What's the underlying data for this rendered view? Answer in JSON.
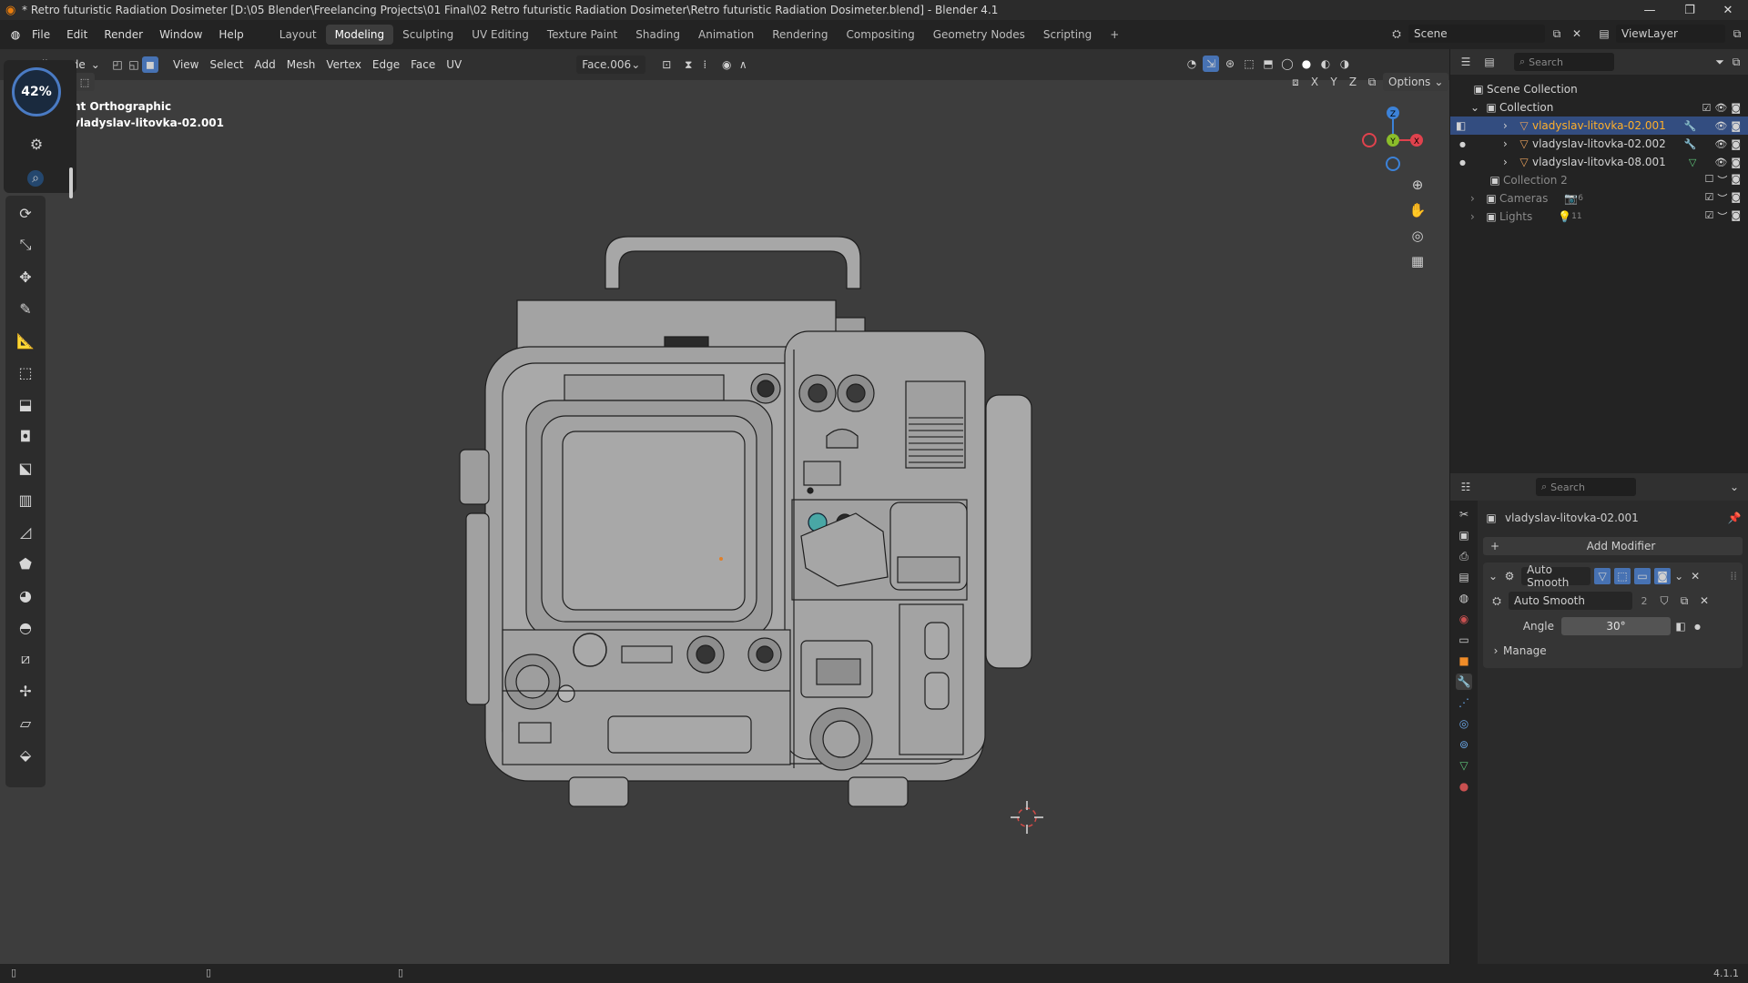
{
  "window": {
    "title": "* Retro futuristic Radiation Dosimeter [D:\\05 Blender\\Freelancing Projects\\01 Final\\02 Retro futuristic Radiation Dosimeter\\Retro futuristic Radiation Dosimeter.blend] - Blender 4.1"
  },
  "menubar": {
    "menus": [
      "File",
      "Edit",
      "Render",
      "Window",
      "Help"
    ],
    "workspaces": [
      "Layout",
      "Modeling",
      "Sculpting",
      "UV Editing",
      "Texture Paint",
      "Shading",
      "Animation",
      "Rendering",
      "Compositing",
      "Geometry Nodes",
      "Scripting",
      "+"
    ],
    "active_workspace": "Modeling",
    "scene_label": "Scene",
    "viewlayer_label": "ViewLayer"
  },
  "viewport_header": {
    "mode": "Edit Mode",
    "menus": [
      "View",
      "Select",
      "Add",
      "Mesh",
      "Vertex",
      "Edge",
      "Face",
      "UV"
    ],
    "active_face": "Face.006",
    "options_label": "Options",
    "axes": [
      "X",
      "Y",
      "Z"
    ]
  },
  "viewport": {
    "view_name": "nt Orthographic",
    "object_name": "vladyslav-litovka-02.001",
    "zoom_badge": "42%",
    "gizmo_axes": [
      "Z",
      "Y",
      "X"
    ]
  },
  "outliner": {
    "search_placeholder": "Search",
    "scene_collection": "Scene Collection",
    "collection": "Collection",
    "objects": [
      "vladyslav-litovka-02.001",
      "vladyslav-litovka-02.002",
      "vladyslav-litovka-08.001"
    ],
    "collection2": "Collection 2",
    "cameras": "Cameras",
    "cameras_count": "6",
    "lights": "Lights",
    "lights_count": "11"
  },
  "properties": {
    "search_placeholder": "Search",
    "object_name": "vladyslav-litovka-02.001",
    "add_modifier": "Add Modifier",
    "modifier_name": "Auto Smooth",
    "node_group": "Auto Smooth",
    "node_users": "2",
    "angle_label": "Angle",
    "angle_value": "30°",
    "manage_label": "Manage"
  },
  "statusbar": {
    "version": "4.1.1"
  },
  "colors": {
    "accent_blue": "#4772b3",
    "active_tab": "#3d3d3d",
    "selected_object_text": "#ffaf29",
    "axis_x": "#e0424d",
    "axis_y": "#8bbd2a",
    "axis_z": "#3c82d8"
  }
}
